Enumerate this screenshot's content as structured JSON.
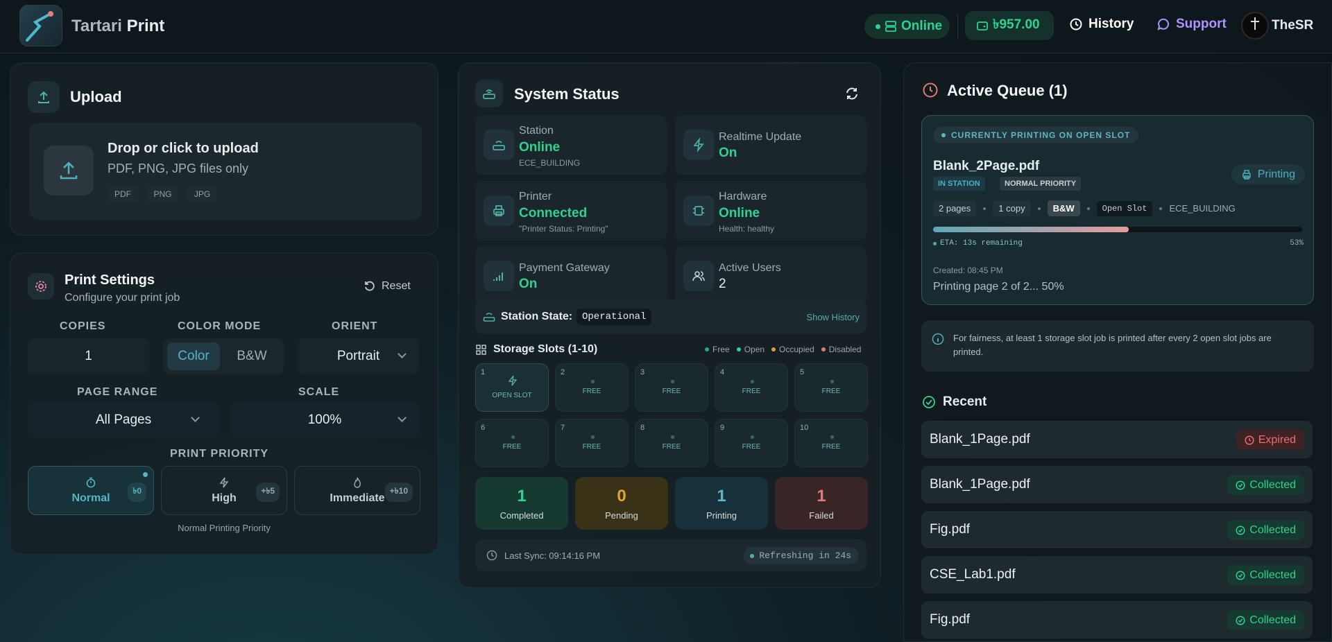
{
  "header": {
    "brand_light": "Tartari",
    "brand_bold": "Print",
    "status": "Online",
    "balance": "৳957.00",
    "history": "History",
    "support": "Support",
    "user": "TheSR"
  },
  "upload": {
    "title": "Upload",
    "drop_title": "Drop or click to upload",
    "drop_sub": "PDF, PNG, JPG files only",
    "formats": [
      "PDF",
      "PNG",
      "JPG"
    ]
  },
  "settings": {
    "title": "Print Settings",
    "subtitle": "Configure your print job",
    "reset": "Reset",
    "copies_label": "COPIES",
    "copies": "1",
    "color_label": "COLOR MODE",
    "color_on": "Color",
    "color_off": "B&W",
    "orient_label": "ORIENT",
    "orient": "Portrait",
    "range_label": "PAGE RANGE",
    "range": "All Pages",
    "scale_label": "SCALE",
    "scale": "100%",
    "priority_label": "PRINT PRIORITY",
    "priorities": [
      {
        "name": "Normal",
        "fee": "৳0"
      },
      {
        "name": "High",
        "fee": "+৳5"
      },
      {
        "name": "Immediate",
        "fee": "+৳10"
      }
    ],
    "priority_note": "Normal Printing Priority"
  },
  "system": {
    "title": "System Status",
    "cards": [
      {
        "label": "Station",
        "value": "Online",
        "detail": "ECE_BUILDING",
        "icon": "router-icon"
      },
      {
        "label": "Realtime Update",
        "value": "On",
        "detail": "",
        "icon": "lightning-icon"
      },
      {
        "label": "Printer",
        "value": "Connected",
        "detail": "\"Printer Status: Printing\"",
        "icon": "printer-icon"
      },
      {
        "label": "Hardware",
        "value": "Online",
        "detail": "Health: healthy",
        "icon": "chip-icon"
      },
      {
        "label": "Payment Gateway",
        "value": "On",
        "detail": "",
        "icon": "signal-icon"
      },
      {
        "label": "Active Users",
        "value": "2",
        "detail": "",
        "icon": "users-icon"
      }
    ],
    "station_state_label": "Station State:",
    "station_state": "Operational",
    "show_history": "Show History",
    "slots_title": "Storage Slots (1-10)",
    "legend": [
      {
        "label": "Free",
        "color": "#2ea39a"
      },
      {
        "label": "Open",
        "color": "#31d18f"
      },
      {
        "label": "Occupied",
        "color": "#e0a12a"
      },
      {
        "label": "Disabled",
        "color": "#d77d7d"
      }
    ],
    "slots": [
      {
        "n": "1",
        "s": "OPEN SLOT"
      },
      {
        "n": "2",
        "s": "FREE"
      },
      {
        "n": "3",
        "s": "FREE"
      },
      {
        "n": "4",
        "s": "FREE"
      },
      {
        "n": "5",
        "s": "FREE"
      },
      {
        "n": "6",
        "s": "FREE"
      },
      {
        "n": "7",
        "s": "FREE"
      },
      {
        "n": "8",
        "s": "FREE"
      },
      {
        "n": "9",
        "s": "FREE"
      },
      {
        "n": "10",
        "s": "FREE"
      }
    ],
    "counters": [
      {
        "value": "1",
        "label": "Completed",
        "color": "#31d18f",
        "bg": "#163a31"
      },
      {
        "value": "0",
        "label": "Pending",
        "color": "#e5a52b",
        "bg": "#3a3217"
      },
      {
        "value": "1",
        "label": "Printing",
        "color": "#5fb6c9",
        "bg": "#183039"
      },
      {
        "value": "1",
        "label": "Failed",
        "color": "#e27a7a",
        "bg": "#3a2526"
      }
    ],
    "last_sync": "Last Sync: 09:14:16 PM",
    "refreshing": "Refreshing in 24s"
  },
  "queue": {
    "title": "Active Queue (1)",
    "banner": "CURRENTLY PRINTING ON OPEN SLOT",
    "file": "Blank_2Page.pdf",
    "badge1": "IN STATION",
    "badge2": "NORMAL PRIORITY",
    "status": "Printing",
    "chips": [
      "2 pages",
      "1 copy",
      "B&W",
      "Open Slot",
      "ECE_BUILDING"
    ],
    "progress": 0.53,
    "eta": "ETA: 13s remaining",
    "percent": "53%",
    "created": "Created: 08:45 PM",
    "message": "Printing page 2 of 2... 50%",
    "fairness": "For fairness, at least 1 storage slot job is printed after every 2 open slot jobs are printed."
  },
  "recent": {
    "title": "Recent",
    "items": [
      {
        "file": "Blank_1Page.pdf",
        "status": "Expired"
      },
      {
        "file": "Blank_1Page.pdf",
        "status": "Collected"
      },
      {
        "file": "Fig.pdf",
        "status": "Collected"
      },
      {
        "file": "CSE_Lab1.pdf",
        "status": "Collected"
      },
      {
        "file": "Fig.pdf",
        "status": "Collected"
      }
    ]
  }
}
